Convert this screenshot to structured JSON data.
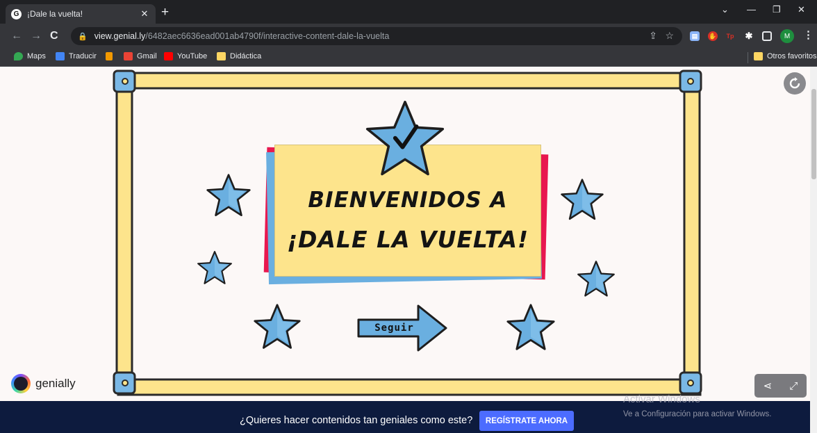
{
  "browser": {
    "tab_title": "¡Dale la vuelta!",
    "tab_favicon": "G",
    "url_host": "view.genial.ly",
    "url_path": "/6482aec6636ead001ab4790f/interactive-content-dale-la-vuelta",
    "profile_initial": "M",
    "bookmarks": [
      "Maps",
      "Traducir",
      "Gmail",
      "YouTube",
      "Didáctica"
    ],
    "other_bookmarks": "Otros favoritos"
  },
  "slide": {
    "title_line1": "BIENVENIDOS A",
    "title_line2": "¡DALE LA VUELTA!",
    "next_button_label": "Seguir",
    "brand": "genially"
  },
  "banner": {
    "text": "¿Quieres hacer contenidos tan geniales como este?",
    "cta_label": "REGÍSTRATE AHORA"
  },
  "os_watermark": {
    "line1": "Activar Windows",
    "line2": "Ve a Configuración para activar Windows."
  },
  "colors": {
    "frame_yellow": "#fde48c",
    "star_blue": "#6aafe0",
    "card_red": "#e8184f",
    "banner_bg": "#0d1b3e",
    "cta_blue": "#4c6cff"
  }
}
